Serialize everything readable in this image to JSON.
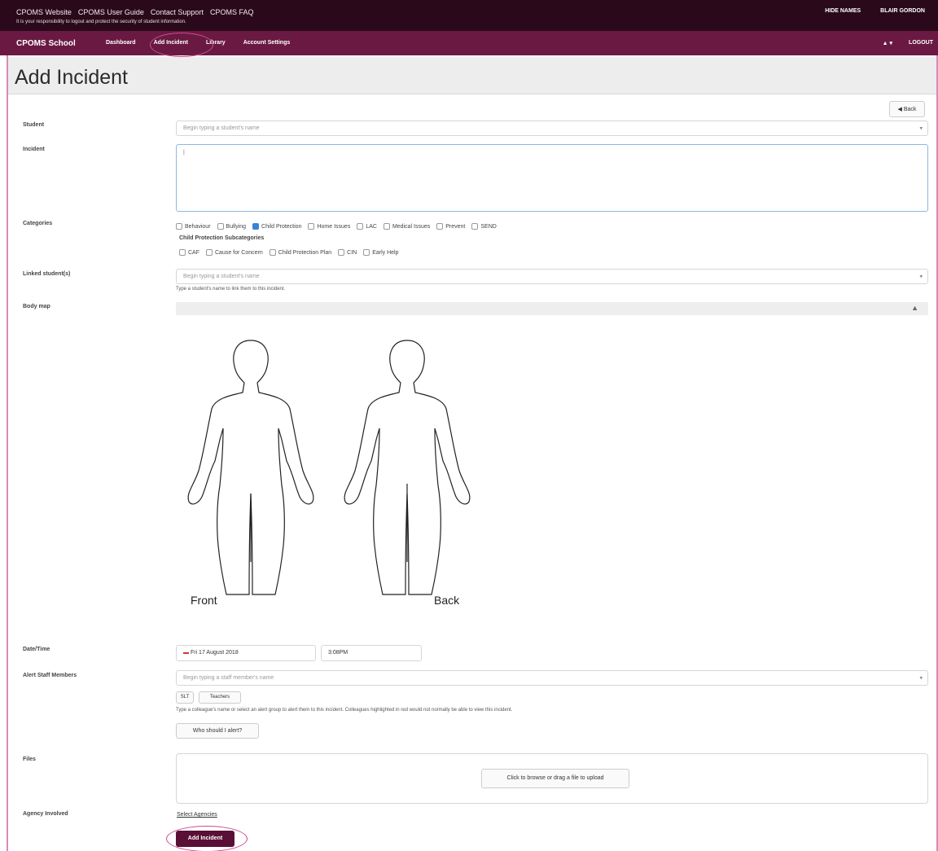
{
  "topbar": {
    "links": [
      "CPOMS Website",
      "CPOMS User Guide",
      "Contact Support",
      "CPOMS FAQ"
    ],
    "note": "It is your responsibility to logout and protect the security of student information.",
    "hide_names": "HIDE NAMES",
    "user": "BLAIR GORDON"
  },
  "navbar": {
    "brand": "CPOMS School",
    "items": [
      "Dashboard",
      "Add Incident",
      "Library",
      "Account Settings"
    ],
    "user_menu": "▲ ▾",
    "logout": "LOGOUT"
  },
  "page": {
    "title": "Add Incident",
    "back_label": "◀ Back"
  },
  "form": {
    "student": {
      "label": "Student",
      "placeholder": "Begin typing a student's name"
    },
    "incident": {
      "label": "Incident",
      "value": "|"
    },
    "categories": {
      "label": "Categories",
      "options": [
        {
          "label": "Behaviour",
          "checked": false
        },
        {
          "label": "Bullying",
          "checked": false
        },
        {
          "label": "Child Protection",
          "checked": true
        },
        {
          "label": "Home Issues",
          "checked": false
        },
        {
          "label": "LAC",
          "checked": false
        },
        {
          "label": "Medical Issues",
          "checked": false
        },
        {
          "label": "Prevent",
          "checked": false
        },
        {
          "label": "SEND",
          "checked": false
        }
      ],
      "sub_heading": "Child Protection Subcategories",
      "sub_options": [
        "CAF",
        "Cause for Concern",
        "Child Protection Plan",
        "CIN",
        "Early Help"
      ]
    },
    "linked": {
      "label": "Linked student(s)",
      "placeholder": "Begin typing a student's name",
      "help": "Type a student's name to link them to this incident."
    },
    "body_map": {
      "label": "Body map",
      "toggle": "▲",
      "front": "Front",
      "back": "Back"
    },
    "datetime": {
      "label": "Date/Time",
      "date": "Fri 17 August 2018",
      "time": "3:08PM"
    },
    "alert": {
      "label": "Alert Staff Members",
      "placeholder": "Begin typing a staff member's name",
      "groups": [
        "SLT",
        "Teachers"
      ],
      "help": "Type a colleague's name or select an alert group to alert them to this incident. Colleagues highlighted in red would not normally be able to view this incident.",
      "who_button": "Who should I alert?"
    },
    "files": {
      "label": "Files",
      "upload_label": "Click to browse or drag a file to upload"
    },
    "agency": {
      "label": "Agency Involved",
      "link": "Select Agencies"
    },
    "submit": "Add Incident"
  },
  "colors": {
    "topbar": "#2a0a1a",
    "navbar": "#6a1a42",
    "submit": "#5a0f36",
    "highlight_circle": "#c94b8d",
    "checkbox_checked": "#3b82d6"
  }
}
